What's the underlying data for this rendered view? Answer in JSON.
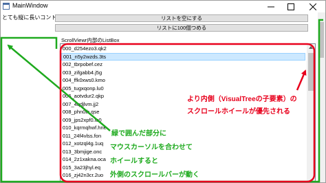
{
  "window": {
    "title": "MainWindow"
  },
  "outer": {
    "label": "とても縦に長いコントロール"
  },
  "buttons": {
    "clear_label": "リストを空にする",
    "fill_label": "リストに100個つめる"
  },
  "scrollviewer": {
    "label": "ScrollViewr内部のListBox"
  },
  "list": {
    "items": [
      {
        "label": "000_d254ezo3.qk2",
        "selected": false
      },
      {
        "label": "001_n5y2wzds.3ts",
        "selected": true
      },
      {
        "label": "002_tbrpobef.cez",
        "selected": false
      },
      {
        "label": "003_zifgabb4.j5g",
        "selected": false
      },
      {
        "label": "004_ffk0xws0.kmo",
        "selected": false
      },
      {
        "label": "005_tugxqonp.lu0",
        "selected": false
      },
      {
        "label": "006_aotvdur2.qkp",
        "selected": false
      },
      {
        "label": "007_4qdjlvm.jj2",
        "selected": false
      },
      {
        "label": "008_phn0ih.qse",
        "selected": false
      },
      {
        "label": "009_jps2xpf0.lu0",
        "selected": false
      },
      {
        "label": "010_kqrmqhwf.hne",
        "selected": false
      },
      {
        "label": "011_24f4vlss.fon",
        "selected": false
      },
      {
        "label": "012_xotzql4g.1uq",
        "selected": false
      },
      {
        "label": "013_3bmjige.onc",
        "selected": false
      },
      {
        "label": "014_2z1xakna.oca",
        "selected": false
      },
      {
        "label": "015_3a23jhyl.eq",
        "selected": false
      },
      {
        "label": "016_zj42n3cr.2uo",
        "selected": false
      }
    ]
  },
  "annotations": {
    "red_line1": "より内側（VisualTreeの子要素）の",
    "red_line2": "スクロールホイールが優先される",
    "green_line1": "緑で囲んだ部分に",
    "green_line2": "マウスカーソルを合わせて",
    "green_line3": "ホイールすると",
    "green_line4": "外側のスクロールバーが動く"
  },
  "colors": {
    "red": "#e8001c",
    "green": "#1eaa1e",
    "selection": "#cce8ff"
  }
}
